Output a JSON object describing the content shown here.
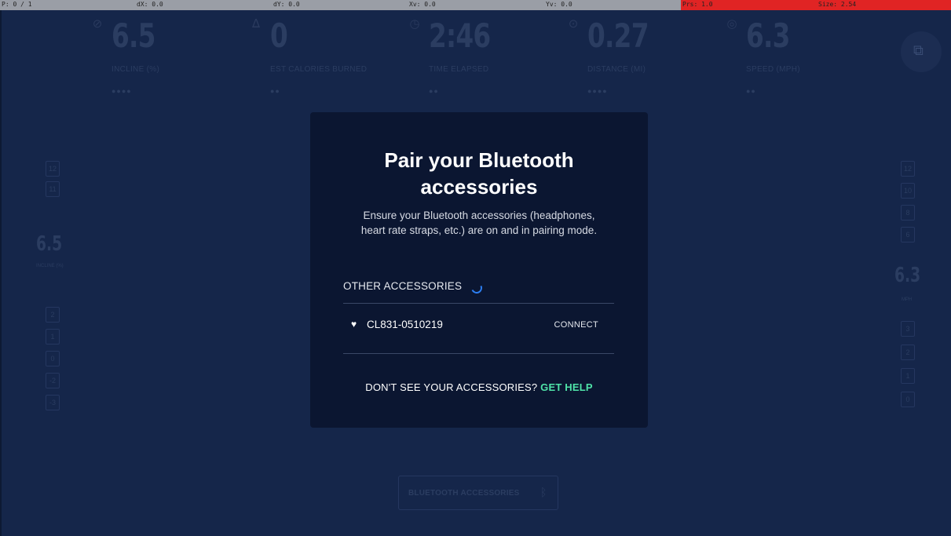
{
  "debug": {
    "p": "P: 0 / 1",
    "dx": "dX: 0.0",
    "dy": "dY: 0.0",
    "xv": "Xv: 0.0",
    "yv": "Yv: 0.0",
    "prs": "Prs: 1.0",
    "size": "Size: 2.54"
  },
  "metrics": [
    {
      "icon": "gauge-icon",
      "glyph": "⊘",
      "value": "6.5",
      "label": "INCLINE (%)",
      "dots": "●●●●"
    },
    {
      "icon": "flame-icon",
      "glyph": "ᐃ",
      "value": "0",
      "label": "EST CALORIES BURNED",
      "dots": "●●"
    },
    {
      "icon": "stopwatch-icon",
      "glyph": "◷",
      "value": "2:46",
      "label": "TIME ELAPSED",
      "dots": "●●"
    },
    {
      "icon": "distance-icon",
      "glyph": "⊙",
      "value": "0.27",
      "label": "DISTANCE (MI)",
      "dots": "●●●●"
    },
    {
      "icon": "speed-icon",
      "glyph": "◎",
      "value": "6.3",
      "label": "SPEED (MPH)",
      "dots": "●●"
    }
  ],
  "incline_ladder": {
    "top_steps": [
      "12",
      "11"
    ],
    "value": "6.5",
    "label": "INCLINE (%)",
    "bottom_steps": [
      "2",
      "1",
      "0",
      "-2",
      "-3"
    ]
  },
  "speed_ladder": {
    "top_steps": [
      "12",
      "10",
      "8",
      "6"
    ],
    "value": "6.3",
    "label": "MPH",
    "bottom_steps": [
      "3",
      "2",
      "1",
      "0"
    ]
  },
  "bottom_button": {
    "label": "BLUETOOTH ACCESSORIES",
    "icon": "bluetooth-icon"
  },
  "modal": {
    "title_line1": "Pair your Bluetooth",
    "title_line2": "accessories",
    "desc_line1": "Ensure your Bluetooth accessories (headphones,",
    "desc_line2": "heart rate straps, etc.) are on and in pairing mode.",
    "section_title": "OTHER ACCESSORIES",
    "device": {
      "name": "CL831-0510219",
      "icon": "heart-rate-icon",
      "action": "CONNECT"
    },
    "help_text": "DON'T SEE YOUR ACCESSORIES?",
    "help_link": "GET HELP"
  },
  "colors": {
    "modal_bg": "#0b1631",
    "accent": "#4fe3a8",
    "spinner": "#2c7df0"
  }
}
